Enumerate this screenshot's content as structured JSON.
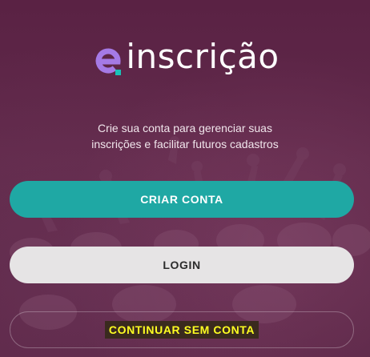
{
  "app": {
    "brand_prefix": "e",
    "brand_name": "inscrição"
  },
  "intro": {
    "line1": "Crie sua conta para gerenciar suas",
    "line2": "inscrições e facilitar futuros cadastros"
  },
  "buttons": {
    "create_account": "CRIAR CONTA",
    "login": "LOGIN",
    "continue_guest": "CONTINUAR SEM CONTA"
  },
  "colors": {
    "background": "#5e2547",
    "primary": "#1fa8a4",
    "secondary": "#e6e4e5",
    "logo_accent_purple": "#a57ae6",
    "logo_accent_teal": "#19c3b8",
    "highlight_text": "#ffff22"
  }
}
